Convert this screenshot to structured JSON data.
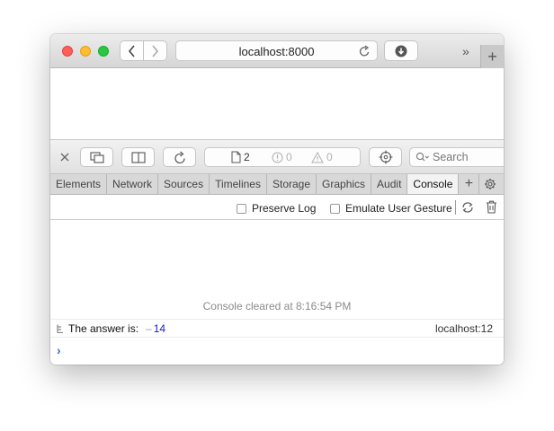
{
  "browser": {
    "url": "localhost:8000",
    "icons": {
      "back": "chevron-left-icon",
      "forward": "chevron-right-icon",
      "reload": "reload-icon",
      "download": "download-icon",
      "overflow": "double-chevron-icon",
      "new_tab": "plus-icon"
    },
    "new_tab_label": "+",
    "overflow_label": "»"
  },
  "inspector": {
    "resources_count": "2",
    "errors_count": "0",
    "warnings_count": "0",
    "search_placeholder": "Search",
    "tabs": [
      {
        "label": "Elements"
      },
      {
        "label": "Network"
      },
      {
        "label": "Sources"
      },
      {
        "label": "Timelines"
      },
      {
        "label": "Storage"
      },
      {
        "label": "Graphics"
      },
      {
        "label": "Audit"
      },
      {
        "label": "Console",
        "active": true
      }
    ],
    "add_tab_label": "+"
  },
  "console": {
    "preserve_log_label": "Preserve Log",
    "emulate_gesture_label": "Emulate User Gesture",
    "cleared_message": "Console cleared at 8:16:54 PM",
    "message": {
      "text": "The answer is:",
      "arrow": "–",
      "value": "14",
      "source": "localhost:12"
    },
    "prompt": "›"
  },
  "colors": {
    "accent": "#2a6ed8",
    "value": "#1c1cb8",
    "close": "#ff5f57",
    "minimize": "#febc2e",
    "zoom": "#28c840"
  }
}
